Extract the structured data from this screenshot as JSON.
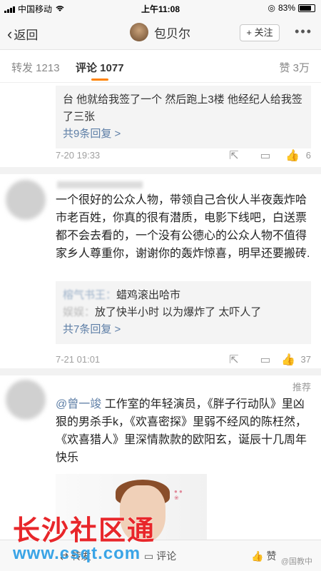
{
  "status_bar": {
    "carrier": "中国移动",
    "time": "上午11:08",
    "battery": "83%",
    "battery_level": 0.83
  },
  "nav": {
    "back_label": "返回",
    "user_name": "包贝尔",
    "follow_label": "+ 关注",
    "more_label": "•••"
  },
  "tabs": {
    "repost": "转发 1213",
    "comments": "评论 1077",
    "likes": "赞 3万"
  },
  "comments": [
    {
      "body": "台 他就给我签了一个 然后跑上3楼 他经纪人给我签了三张",
      "reply_more": "共9条回复 >",
      "date": "7-20 19:33",
      "likes": "6"
    },
    {
      "body": "一个很好的公众人物，带领自己合伙人半夜轰炸哈市老百姓，你真的很有潜质，电影下线吧，白送票都不会去看的，一个没有公德心的公众人物不值得家乡人尊重你，谢谢你的轰炸惊喜，明早还要搬砖.",
      "reply_line1": "蜡鸡滚出哈市",
      "reply_line2": "放了快半小时 以为爆炸了  太吓人了",
      "reply_more": "共7条回复 >",
      "date": "7-21 01:01",
      "likes": "37"
    },
    {
      "recommend": "推荐",
      "mention": "@曾一竣",
      "body": " 工作室的年轻演员，《胖子行动队》里凶狠的男杀手k，《欢喜密探》里弱不经风的陈枉然，《欢喜猎人》里深情款款的欧阳玄，诞辰十几周年快乐"
    }
  ],
  "bottom_bar": {
    "repost": "转发",
    "comment": "评论",
    "like": "赞"
  },
  "watermark": {
    "title": "长沙社区通",
    "url": "www.csqt.com",
    "weibo": "@国教中"
  }
}
